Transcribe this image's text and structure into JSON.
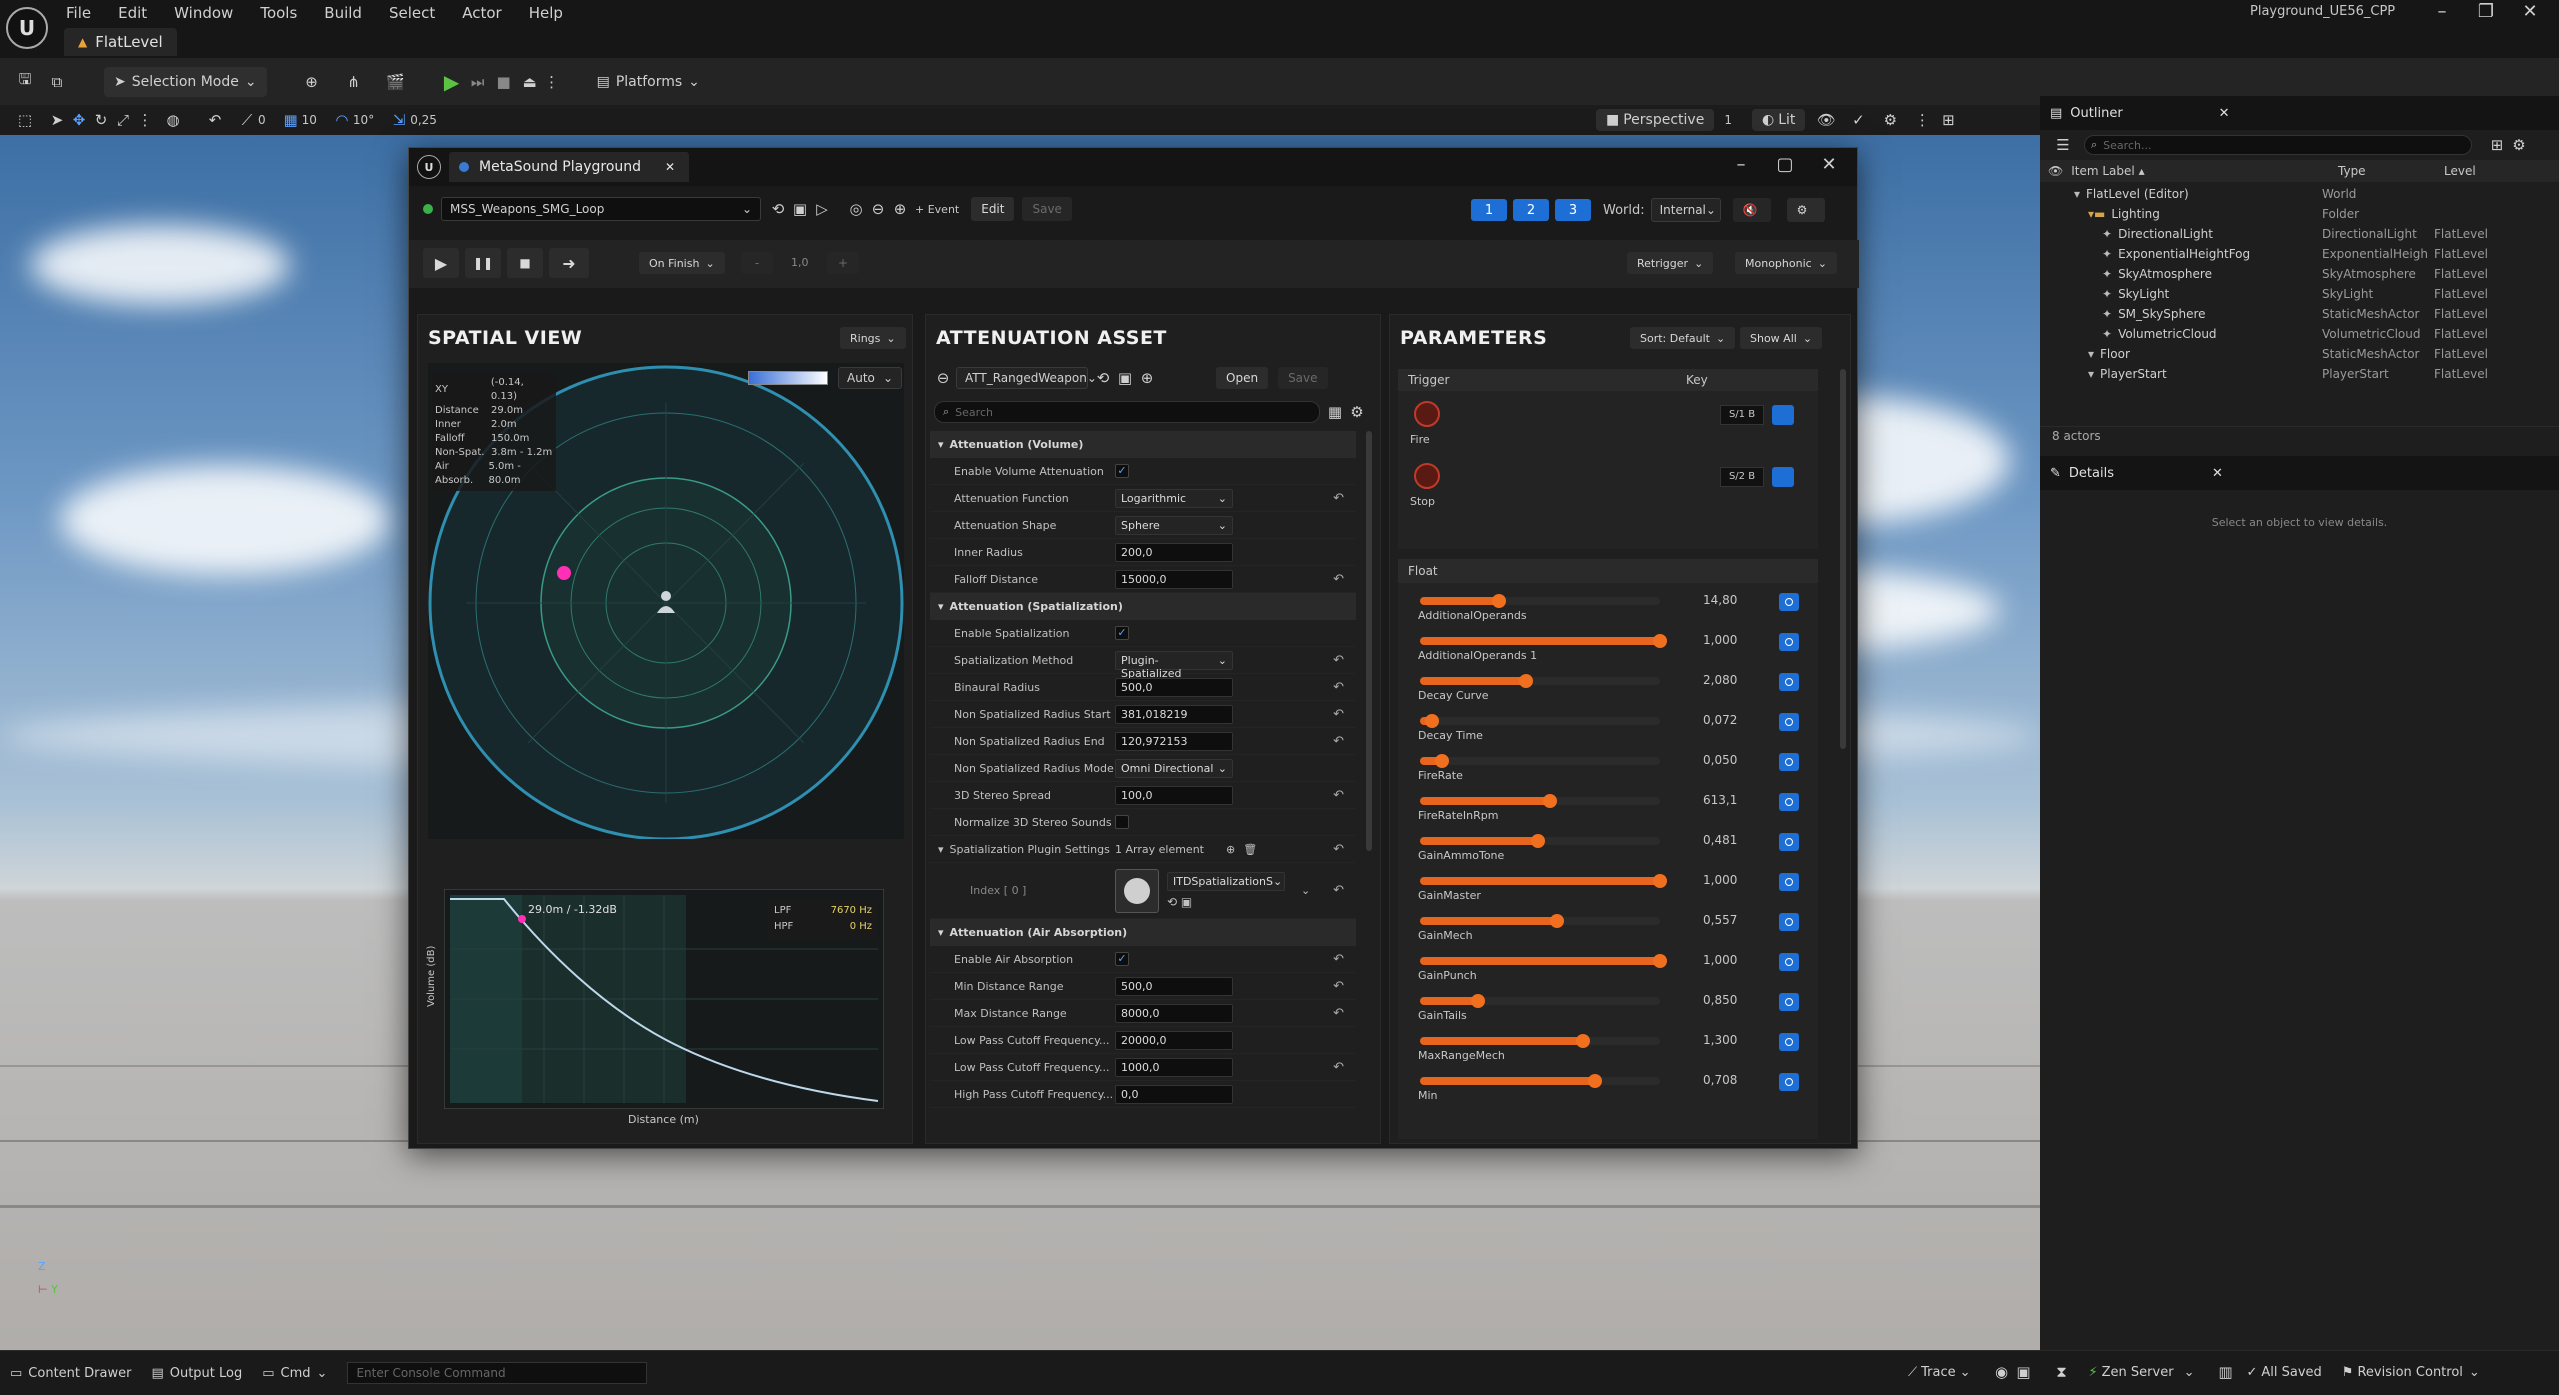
{
  "app": {
    "project": "Playground_UE56_CPP",
    "level_tab": "FlatLevel",
    "menu": [
      "File",
      "Edit",
      "Window",
      "Tools",
      "Build",
      "Select",
      "Actor",
      "Help"
    ]
  },
  "toolbar": {
    "mode": "Selection Mode",
    "platforms": "Platforms",
    "snap_translate": "10",
    "snap_rotate": "10°",
    "snap_scale": "0,25",
    "grid_a": "0",
    "perspective": "Perspective",
    "lit": "Lit",
    "cam_speed": "1"
  },
  "metasound": {
    "window_title": "MetaSound Playground",
    "asset": "MSS_Weapons_SMG_Loop",
    "event_btn": "+ Event",
    "edit_btn": "Edit",
    "save_btn": "Save",
    "tabs": [
      "1",
      "2",
      "3"
    ],
    "world_label": "World:",
    "world_value": "Internal",
    "on_finish": "On Finish",
    "pitch_minus": "-",
    "pitch_value": "1,0",
    "pitch_plus": "+",
    "retrigger": "Retrigger",
    "monophonic": "Monophonic"
  },
  "spatial": {
    "title": "SPATIAL VIEW",
    "rings": "Rings",
    "auto": "Auto",
    "info": [
      {
        "k": "XY",
        "v": "(-0.14, 0.13)"
      },
      {
        "k": "Distance",
        "v": "29.0m"
      },
      {
        "k": "Inner",
        "v": "2.0m"
      },
      {
        "k": "Falloff",
        "v": "150.0m"
      },
      {
        "k": "Non-Spat.",
        "v": "3.8m - 1.2m"
      },
      {
        "k": "Air Absorb.",
        "v": "5.0m - 80.0m"
      }
    ],
    "curve_label": "29.0m / -1.32dB",
    "lpf_label": "LPF",
    "lpf_value": "7670 Hz",
    "hpf_label": "HPF",
    "hpf_value": "0 Hz",
    "y_axis": "Volume (dB)",
    "x_axis": "Distance (m)"
  },
  "attenuation": {
    "title": "ATTENUATION ASSET",
    "asset": "ATT_RangedWeapon",
    "open": "Open",
    "save": "Save",
    "search_placeholder": "Search",
    "cat_volume": "Attenuation (Volume)",
    "cat_spatial": "Attenuation (Spatialization)",
    "cat_air": "Attenuation (Air Absorption)",
    "volume_rows": [
      {
        "label": "Enable Volume Attenuation",
        "type": "check"
      },
      {
        "label": "Attenuation Function",
        "type": "dd",
        "value": "Logarithmic",
        "reset": true
      },
      {
        "label": "Attenuation Shape",
        "type": "dd",
        "value": "Sphere"
      },
      {
        "label": "Inner Radius",
        "type": "val",
        "value": "200,0"
      },
      {
        "label": "Falloff Distance",
        "type": "val",
        "value": "15000,0",
        "reset": true
      }
    ],
    "spatial_rows": [
      {
        "label": "Enable Spatialization",
        "type": "check"
      },
      {
        "label": "Spatialization Method",
        "type": "dd",
        "value": "Plugin-Spatialized",
        "reset": true
      },
      {
        "label": "Binaural Radius",
        "type": "val",
        "value": "500,0",
        "reset": true
      },
      {
        "label": "Non Spatialized Radius Start",
        "type": "val",
        "value": "381,018219",
        "reset": true
      },
      {
        "label": "Non Spatialized Radius End",
        "type": "val",
        "value": "120,972153",
        "reset": true
      },
      {
        "label": "Non Spatialized Radius Mode",
        "type": "dd",
        "value": "Omni Directional"
      },
      {
        "label": "3D Stereo Spread",
        "type": "val",
        "value": "100,0",
        "reset": true
      },
      {
        "label": "Normalize 3D Stereo Sounds",
        "type": "uncheck"
      }
    ],
    "plugin_settings_label": "Spatialization Plugin Settings",
    "plugin_settings_value": "1 Array element",
    "index_label": "Index [ 0 ]",
    "index_value": "ITDSpatializationS",
    "air_rows": [
      {
        "label": "Enable Air Absorption",
        "type": "check",
        "reset": true
      },
      {
        "label": "Min Distance Range",
        "type": "val",
        "value": "500,0",
        "reset": true
      },
      {
        "label": "Max Distance Range",
        "type": "val",
        "value": "8000,0",
        "reset": true
      },
      {
        "label": "Low Pass Cutoff Frequency...",
        "type": "val",
        "value": "20000,0"
      },
      {
        "label": "Low Pass Cutoff Frequency...",
        "type": "val",
        "value": "1000,0",
        "reset": true
      },
      {
        "label": "High Pass Cutoff Frequency...",
        "type": "val",
        "value": "0,0"
      }
    ]
  },
  "parameters": {
    "title": "PARAMETERS",
    "sort": "Sort: Default",
    "show": "Show All",
    "trigger_header": "Trigger",
    "key_header": "Key",
    "triggers": [
      {
        "name": "Fire",
        "key": "S/1 B"
      },
      {
        "name": "Stop",
        "key": "S/2 B"
      }
    ],
    "float_header": "Float",
    "floats": [
      {
        "name": "AdditionalOperands",
        "value": "14,80",
        "fill": 0.33
      },
      {
        "name": "AdditionalOperands 1",
        "value": "1,000",
        "fill": 1.0
      },
      {
        "name": "Decay Curve",
        "value": "2,080",
        "fill": 0.44
      },
      {
        "name": "Decay Time",
        "value": "0,072",
        "fill": 0.05
      },
      {
        "name": "FireRate",
        "value": "0,050",
        "fill": 0.09
      },
      {
        "name": "FireRateInRpm",
        "value": "613,1",
        "fill": 0.54
      },
      {
        "name": "GainAmmoTone",
        "value": "0,481",
        "fill": 0.49
      },
      {
        "name": "GainMaster",
        "value": "1,000",
        "fill": 1.0
      },
      {
        "name": "GainMech",
        "value": "0,557",
        "fill": 0.57
      },
      {
        "name": "GainPunch",
        "value": "1,000",
        "fill": 1.0
      },
      {
        "name": "GainTails",
        "value": "0,850",
        "fill": 0.24
      },
      {
        "name": "MaxRangeMech",
        "value": "1,300",
        "fill": 0.68
      },
      {
        "name": "Min",
        "value": "0,708",
        "fill": 0.73
      }
    ]
  },
  "outliner": {
    "title": "Outliner",
    "search_placeholder": "Search...",
    "col_label": "Item Label",
    "col_type": "Type",
    "col_level": "Level",
    "rows": [
      {
        "name": "FlatLevel (Editor)",
        "type": "World",
        "level": "",
        "indent": 0
      },
      {
        "name": "Lighting",
        "type": "Folder",
        "level": "",
        "indent": 1
      },
      {
        "name": "DirectionalLight",
        "type": "DirectionalLight",
        "level": "FlatLevel",
        "indent": 2
      },
      {
        "name": "ExponentialHeightFog",
        "type": "ExponentialHeigh",
        "level": "FlatLevel",
        "indent": 2
      },
      {
        "name": "SkyAtmosphere",
        "type": "SkyAtmosphere",
        "level": "FlatLevel",
        "indent": 2
      },
      {
        "name": "SkyLight",
        "type": "SkyLight",
        "level": "FlatLevel",
        "indent": 2
      },
      {
        "name": "SM_SkySphere",
        "type": "StaticMeshActor",
        "level": "FlatLevel",
        "indent": 2
      },
      {
        "name": "VolumetricCloud",
        "type": "VolumetricCloud",
        "level": "FlatLevel",
        "indent": 2
      },
      {
        "name": "Floor",
        "type": "StaticMeshActor",
        "level": "FlatLevel",
        "indent": 1
      },
      {
        "name": "PlayerStart",
        "type": "PlayerStart",
        "level": "FlatLevel",
        "indent": 1
      }
    ],
    "count": "8 actors",
    "details_title": "Details",
    "details_empty": "Select an object to view details."
  },
  "status": {
    "content_drawer": "Content Drawer",
    "output_log": "Output Log",
    "cmd": "Cmd",
    "console_placeholder": "Enter Console Command",
    "trace": "Trace",
    "zen": "Zen Server",
    "saved": "All Saved",
    "revision": "Revision Control"
  }
}
